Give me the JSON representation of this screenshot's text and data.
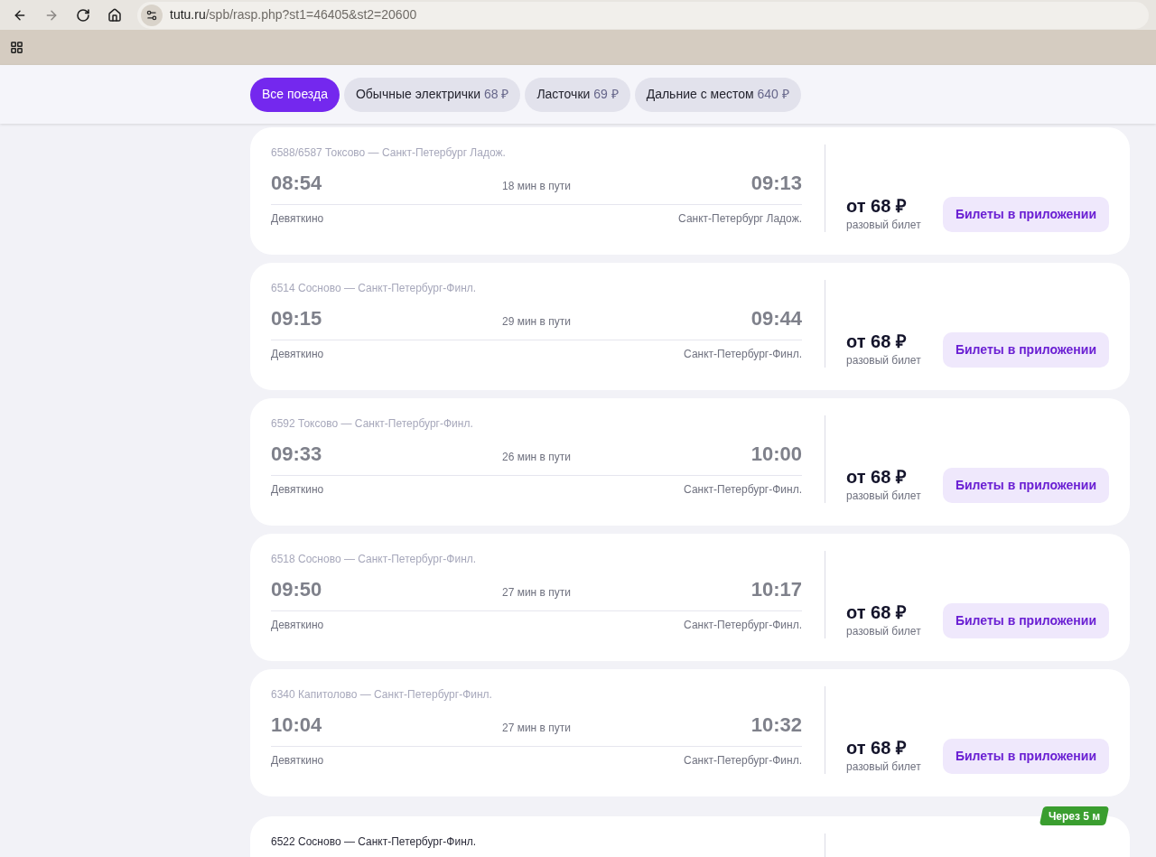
{
  "browser": {
    "url_host": "tutu.ru",
    "url_path": "/spb/rasp.php?st1=46405&st2=20600"
  },
  "filters": [
    {
      "label": "Все поезда",
      "selected": true
    },
    {
      "label": "Обычные электрички",
      "price": "68 ₽",
      "selected": false
    },
    {
      "label": "Ласточки",
      "price": "69 ₽",
      "selected": false
    },
    {
      "label": "Дальние с местом",
      "price": "640 ₽",
      "selected": false
    }
  ],
  "trains": [
    {
      "title": "6588/6587 Токсово — Санкт-Петербург Ладож.",
      "departure": "08:54",
      "duration": "18 мин в пути",
      "arrival": "09:13",
      "from": "Девяткино",
      "to": "Санкт-Петербург Ладож.",
      "price": "от 68 ₽",
      "price_note": "разовый билет",
      "button": "Билеты в приложении",
      "departed": true
    },
    {
      "title": "6514 Сосново — Санкт-Петербург-Финл.",
      "departure": "09:15",
      "duration": "29 мин в пути",
      "arrival": "09:44",
      "from": "Девяткино",
      "to": "Санкт-Петербург-Финл.",
      "price": "от 68 ₽",
      "price_note": "разовый билет",
      "button": "Билеты в приложении",
      "departed": true
    },
    {
      "title": "6592 Токсово — Санкт-Петербург-Финл.",
      "departure": "09:33",
      "duration": "26 мин в пути",
      "arrival": "10:00",
      "from": "Девяткино",
      "to": "Санкт-Петербург-Финл.",
      "price": "от 68 ₽",
      "price_note": "разовый билет",
      "button": "Билеты в приложении",
      "departed": true
    },
    {
      "title": "6518 Сосново — Санкт-Петербург-Финл.",
      "departure": "09:50",
      "duration": "27 мин в пути",
      "arrival": "10:17",
      "from": "Девяткино",
      "to": "Санкт-Петербург-Финл.",
      "price": "от 68 ₽",
      "price_note": "разовый билет",
      "button": "Билеты в приложении",
      "departed": true
    },
    {
      "title": "6340 Капитолово — Санкт-Петербург-Финл.",
      "departure": "10:04",
      "duration": "27 мин в пути",
      "arrival": "10:32",
      "from": "Девяткино",
      "to": "Санкт-Петербург-Финл.",
      "price": "от 68 ₽",
      "price_note": "разовый билет",
      "button": "Билеты в приложении",
      "departed": true
    },
    {
      "title": "6522 Сосново — Санкт-Петербург-Финл.",
      "badge": "Через 5 м",
      "departed": false
    }
  ]
}
